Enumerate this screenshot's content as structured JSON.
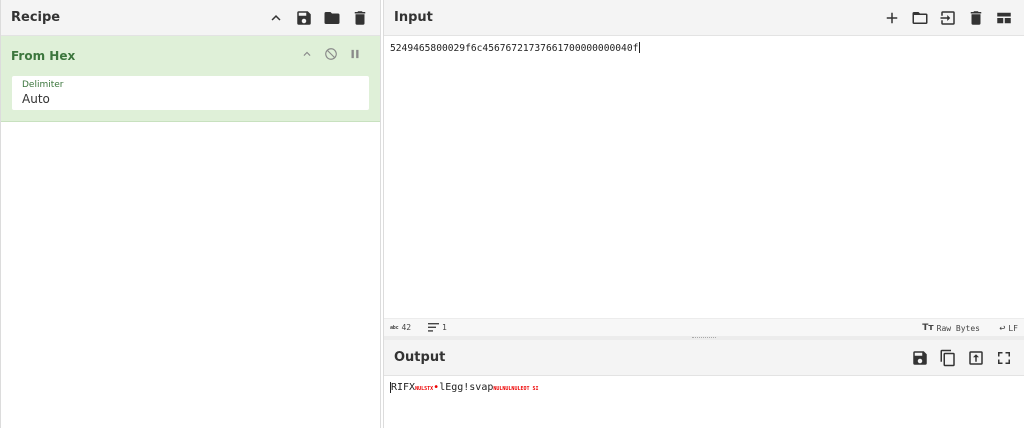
{
  "recipe": {
    "title": "Recipe",
    "operation": {
      "name": "From Hex",
      "delimiter_label": "Delimiter",
      "delimiter_value": "Auto"
    }
  },
  "input": {
    "title": "Input",
    "text": "5249465800029f6c45676721737661700000000040f",
    "status": {
      "length_badge": "abc",
      "length": "42",
      "lines": "1",
      "encoding": "Raw Bytes",
      "eol": "LF"
    }
  },
  "output": {
    "title": "Output",
    "segments": [
      {
        "text": "RIFX",
        "ctrl": false
      },
      {
        "text": "NULSTX",
        "ctrl": true
      },
      {
        "text": "•",
        "dot": true
      },
      {
        "text": "lEgg!svap",
        "ctrl": false
      },
      {
        "text": "NULNULNULEOT SI",
        "ctrl": true
      }
    ]
  }
}
